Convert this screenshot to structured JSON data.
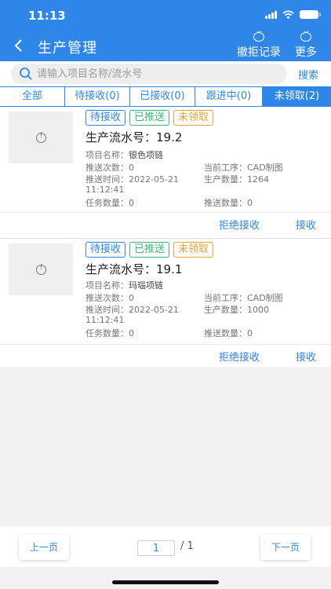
{
  "status_bar": {
    "time": "11:13"
  },
  "header": {
    "title": "生产管理",
    "record_label": "撤拒记录",
    "more_label": "更多"
  },
  "search": {
    "placeholder": "请输入项目名称/流水号",
    "button_label": "搜索"
  },
  "tabs": [
    {
      "label": "全部"
    },
    {
      "label": "待接收(0)"
    },
    {
      "label": "已接收(0)"
    },
    {
      "label": "跟进中(0)"
    },
    {
      "label": "未领取(2)",
      "active": true
    }
  ],
  "cards": [
    {
      "tags": [
        "待接收",
        "已推送",
        "未领取"
      ],
      "serial": "生产流水号：19.2",
      "project_label": "项目名称：",
      "project_value": "银色项链",
      "push_count_label": "推送次数：",
      "push_count_value": "0",
      "process_label": "当前工序：",
      "process_value": "CAD制图",
      "push_time_label": "推送时间：",
      "push_time_date": "2022-05-21",
      "push_time_clock": "11:12:41",
      "quantity_label": "生产数量：",
      "quantity_value": "1264",
      "task_qty_label": "任务数量：",
      "task_qty_value": "0",
      "pushed_qty_label": "推送数量：",
      "pushed_qty_value": "0",
      "reject_label": "拒绝接收",
      "accept_label": "接收"
    },
    {
      "tags": [
        "待接收",
        "已推送",
        "未领取"
      ],
      "serial": "生产流水号：19.1",
      "project_label": "项目名称：",
      "project_value": "玛瑙项链",
      "push_count_label": "推送次数：",
      "push_count_value": "0",
      "process_label": "当前工序：",
      "process_value": "CAD制图",
      "push_time_label": "推送时间：",
      "push_time_date": "2022-05-21",
      "push_time_clock": "11:12:41",
      "quantity_label": "生产数量：",
      "quantity_value": "1000",
      "task_qty_label": "任务数量：",
      "task_qty_value": "0",
      "pushed_qty_label": "推送数量：",
      "pushed_qty_value": "0",
      "reject_label": "拒绝接收",
      "accept_label": "接收"
    }
  ],
  "pager": {
    "prev_label": "上一页",
    "next_label": "下一页",
    "current": "1",
    "total": "/ 1"
  },
  "colors": {
    "primary": "#2e86e8",
    "green": "#3cb878",
    "orange": "#e8a23a"
  }
}
